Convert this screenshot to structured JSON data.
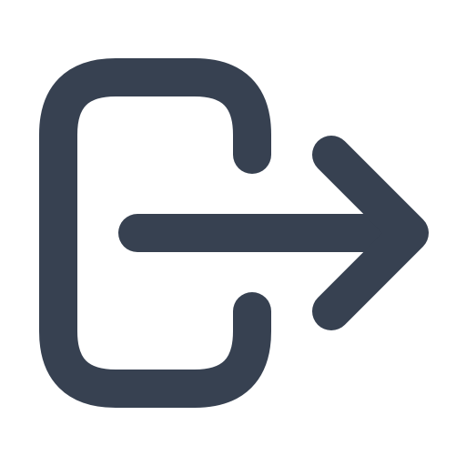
{
  "icon": {
    "name": "logout-icon",
    "color": "#374151",
    "background": "#ffffff"
  }
}
